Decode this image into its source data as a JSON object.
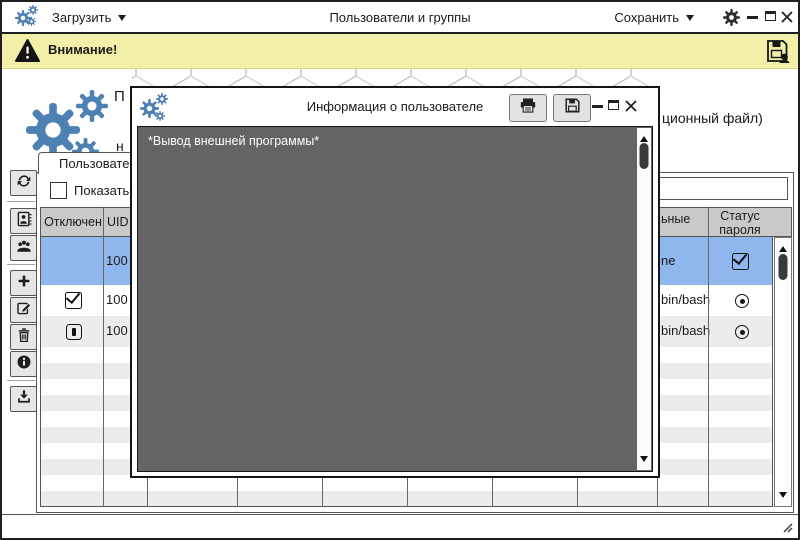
{
  "colors": {
    "accent_blue": "#4d80b3",
    "selection_blue": "#8fb7ee",
    "warning_yellow": "#f1efa8",
    "console_gray": "#646464",
    "header_gray": "#c9c9c9"
  },
  "titlebar": {
    "load_menu": "Загрузить",
    "app_title": "Пользователи и группы",
    "save_menu": "Сохранить"
  },
  "warning_bar": {
    "message": "Внимание!"
  },
  "intro": {
    "line1_fragment": "П",
    "line2_right_fragment": "ционный файл)",
    "line3_fragment": "н"
  },
  "tabs": {
    "users_tab_fragment": "Пользовате"
  },
  "filter": {
    "checkbox_label_fragment": "Показать",
    "search_value": ""
  },
  "toolbar": {
    "buttons": [
      "refresh",
      "address-book",
      "groups",
      "add",
      "edit",
      "delete",
      "info",
      "import"
    ]
  },
  "table": {
    "headers": {
      "disabled": "Отключен",
      "uid": "UID",
      "extra_fragment": "ьные",
      "password_status": "Статус пароля"
    },
    "rows": [
      {
        "uid": "100",
        "shell_fragment": "ne",
        "disabled": "",
        "password_status": "checked",
        "selected": true
      },
      {
        "uid": "100",
        "shell_fragment": "bin/bash",
        "disabled": "checked",
        "password_status": "dot",
        "selected": false
      },
      {
        "uid": "100",
        "shell_fragment": "bin/bash",
        "disabled": "indeterminate",
        "password_status": "dot",
        "selected": false
      }
    ]
  },
  "dialog": {
    "title": "Информация о пользователе",
    "console_output": "*Вывод внешней программы*"
  }
}
